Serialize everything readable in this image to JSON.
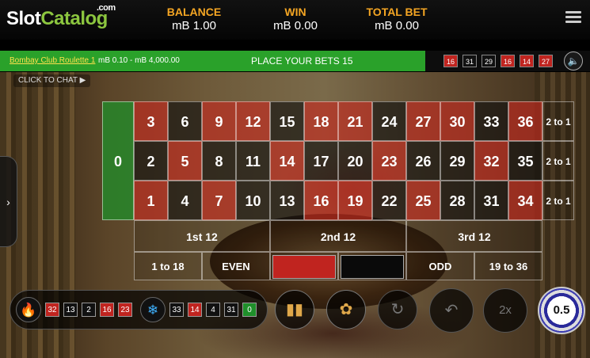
{
  "logo": {
    "part1": "Slot",
    "part2": "Catalog",
    "suffix": ".com"
  },
  "header": {
    "balance_label": "BALANCE",
    "balance_value": "mB 1.00",
    "win_label": "WIN",
    "win_value": "mB 0.00",
    "total_bet_label": "TOTAL BET",
    "total_bet_value": "mB 0.00",
    "menu_icon": "hamburger-icon"
  },
  "infobar": {
    "table_name": "Bombay Club Roulette 1",
    "limits": "mB 0.10 - mB 4,000.00",
    "status": "PLACE YOUR BETS 15"
  },
  "recent_results": [
    {
      "n": "16",
      "c": "red"
    },
    {
      "n": "31",
      "c": "black"
    },
    {
      "n": "29",
      "c": "black"
    },
    {
      "n": "16",
      "c": "red"
    },
    {
      "n": "14",
      "c": "red"
    },
    {
      "n": "27",
      "c": "red"
    }
  ],
  "sound_icon": "speaker-icon",
  "chat_label": "CLICK TO CHAT",
  "side_tab_icon": "chevron-right-icon",
  "table": {
    "zero": "0",
    "rows": [
      [
        {
          "n": "3",
          "c": "r"
        },
        {
          "n": "6",
          "c": "b"
        },
        {
          "n": "9",
          "c": "r"
        },
        {
          "n": "12",
          "c": "r"
        },
        {
          "n": "15",
          "c": "b"
        },
        {
          "n": "18",
          "c": "r"
        },
        {
          "n": "21",
          "c": "r"
        },
        {
          "n": "24",
          "c": "b"
        },
        {
          "n": "27",
          "c": "r"
        },
        {
          "n": "30",
          "c": "r"
        },
        {
          "n": "33",
          "c": "b"
        },
        {
          "n": "36",
          "c": "r"
        }
      ],
      [
        {
          "n": "2",
          "c": "b"
        },
        {
          "n": "5",
          "c": "r"
        },
        {
          "n": "8",
          "c": "b"
        },
        {
          "n": "11",
          "c": "b"
        },
        {
          "n": "14",
          "c": "r"
        },
        {
          "n": "17",
          "c": "b"
        },
        {
          "n": "20",
          "c": "b"
        },
        {
          "n": "23",
          "c": "r"
        },
        {
          "n": "26",
          "c": "b"
        },
        {
          "n": "29",
          "c": "b"
        },
        {
          "n": "32",
          "c": "r"
        },
        {
          "n": "35",
          "c": "b"
        }
      ],
      [
        {
          "n": "1",
          "c": "r"
        },
        {
          "n": "4",
          "c": "b"
        },
        {
          "n": "7",
          "c": "r"
        },
        {
          "n": "10",
          "c": "b"
        },
        {
          "n": "13",
          "c": "b"
        },
        {
          "n": "16",
          "c": "r"
        },
        {
          "n": "19",
          "c": "r"
        },
        {
          "n": "22",
          "c": "b"
        },
        {
          "n": "25",
          "c": "r"
        },
        {
          "n": "28",
          "c": "b"
        },
        {
          "n": "31",
          "c": "b"
        },
        {
          "n": "34",
          "c": "r"
        }
      ]
    ],
    "column_bets": [
      "2 to 1",
      "2 to 1",
      "2 to 1"
    ],
    "dozens": [
      "1st 12",
      "2nd 12",
      "3rd 12"
    ],
    "outside": {
      "low": "1 to 18",
      "even": "EVEN",
      "red_color": "#c0241f",
      "black_color": "#0a0a0a",
      "odd": "ODD",
      "high": "19 to 36"
    }
  },
  "hot_numbers": [
    {
      "n": "32",
      "c": "red"
    },
    {
      "n": "13",
      "c": "black"
    },
    {
      "n": "2",
      "c": "black"
    },
    {
      "n": "16",
      "c": "red"
    },
    {
      "n": "23",
      "c": "red"
    }
  ],
  "cold_numbers": [
    {
      "n": "33",
      "c": "black"
    },
    {
      "n": "14",
      "c": "red"
    },
    {
      "n": "4",
      "c": "black"
    },
    {
      "n": "31",
      "c": "black"
    },
    {
      "n": "0",
      "c": "green"
    }
  ],
  "controls": {
    "statistics_icon": "bar-chart-icon",
    "racetrack_icon": "racetrack-icon",
    "rebet_icon": "rebet-icon",
    "undo_icon": "undo-icon",
    "double_icon": "double-icon",
    "double_label": "2x",
    "chip_value": "0.5"
  }
}
